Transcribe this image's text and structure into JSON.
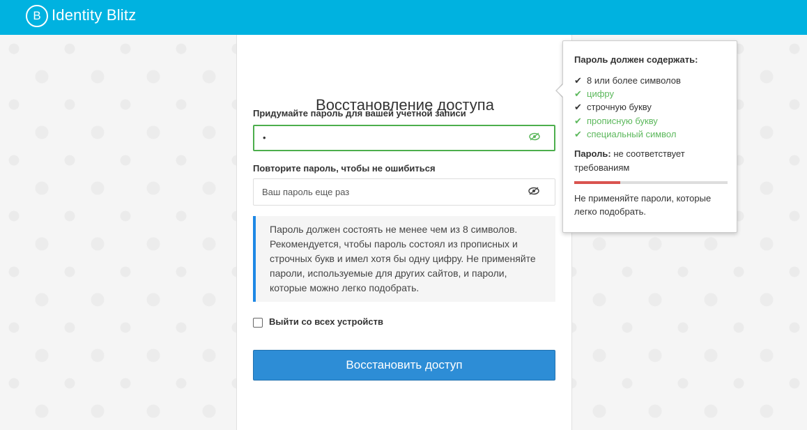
{
  "header": {
    "logo_mark": "B",
    "brand": "Identity Blitz",
    "bg_color": "#00b2e0"
  },
  "card": {
    "title": "Восстановление доступа"
  },
  "password_field": {
    "label": "Придумайте пароль для вашей учетной записи",
    "value": "•",
    "eye_icon": "eye-icon"
  },
  "confirm_field": {
    "label": "Повторите пароль, чтобы не ошибиться",
    "placeholder": "Ваш пароль еще раз",
    "eye_icon": "eye-icon"
  },
  "info_text": "Пароль должен состоять не менее чем из 8 символов. Рекомендуется, чтобы пароль состоял из прописных и строчных букв и имел хотя бы одну цифру. Не применяйте пароли, используемые для других сайтов, и пароли, которые можно легко подобрать.",
  "logout_all": {
    "label": "Выйти со всех устройств",
    "checked": false
  },
  "submit_label": "Восстановить доступ",
  "popover": {
    "heading": "Пароль должен содержать:",
    "requirements": [
      {
        "text": "8 или более символов",
        "met": false
      },
      {
        "text": "цифру",
        "met": true
      },
      {
        "text": "строчную букву",
        "met": false
      },
      {
        "text": "прописную букву",
        "met": true
      },
      {
        "text": "специальный символ",
        "met": true
      }
    ],
    "status_label": "Пароль:",
    "status_value": "не соответствует требованиям",
    "strength_fraction": 0.3,
    "strength_color": "#d9534f",
    "note": "Не применяйте пароли, которые легко подобрать."
  }
}
